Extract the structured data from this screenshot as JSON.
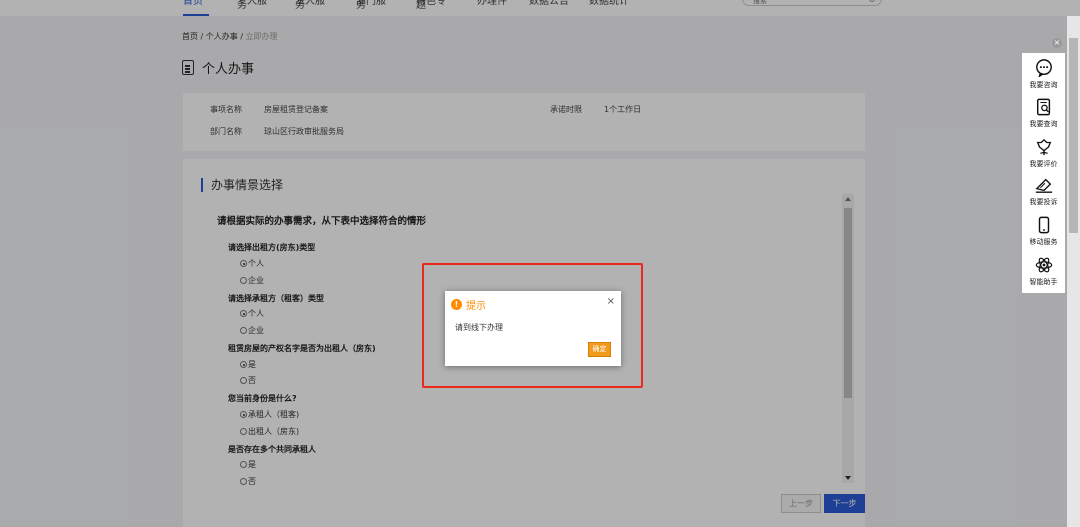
{
  "nav": {
    "items": [
      "首页",
      "个人服务",
      "法人服务",
      "部门服务",
      "特色专题",
      "办理件",
      "数据公告",
      "数据统计"
    ],
    "search_placeholder": "搜索"
  },
  "breadcrumb": {
    "home": "首页",
    "sep1": " / ",
    "section": "个人办事",
    "sep2": " / ",
    "current": "立即办理"
  },
  "page_title": "个人办事",
  "info": {
    "item_name_label": "事项名称",
    "item_name_value": "房屋租赁登记备案",
    "promise_label": "承诺时限",
    "promise_value": "1个工作日",
    "dept_label": "部门名称",
    "dept_value": "琼山区行政审批服务局"
  },
  "section_title": "办事情景选择",
  "question_head": "请根据实际的办事需求，从下表中选择符合的情形",
  "questions": [
    {
      "q": "请选择出租方(房东)类型",
      "options": [
        {
          "label": "个人",
          "checked": true
        },
        {
          "label": "企业",
          "checked": false
        }
      ]
    },
    {
      "q": "请选择承租方（租客）类型",
      "options": [
        {
          "label": "个人",
          "checked": true
        },
        {
          "label": "企业",
          "checked": false
        }
      ]
    },
    {
      "q": "租赁房屋的产权名字是否为出租人（房东)",
      "options": [
        {
          "label": "是",
          "checked": true
        },
        {
          "label": "否",
          "checked": false
        }
      ]
    },
    {
      "q": "您当前身份是什么?",
      "options": [
        {
          "label": "承租人（租客)",
          "checked": true
        },
        {
          "label": "出租人（房东)",
          "checked": false
        }
      ]
    },
    {
      "q": "是否存在多个共同承租人",
      "options": [
        {
          "label": "是",
          "checked": false
        },
        {
          "label": "否",
          "checked": false
        }
      ]
    }
  ],
  "buttons": {
    "prev": "上一步",
    "next": "下一步"
  },
  "side_panel": {
    "close": "×",
    "items": [
      {
        "label": "我要咨询",
        "icon": "chat-icon"
      },
      {
        "label": "我要查询",
        "icon": "search-doc-icon"
      },
      {
        "label": "我要评价",
        "icon": "flower-icon"
      },
      {
        "label": "我要投诉",
        "icon": "pen-icon"
      },
      {
        "label": "移动服务",
        "icon": "phone-icon"
      },
      {
        "label": "智能助手",
        "icon": "atom-icon"
      }
    ]
  },
  "dialog": {
    "title": "提示",
    "icon": "!",
    "close": "×",
    "message": "请到线下办理",
    "ok": "确定"
  },
  "colors": {
    "accent": "#2a5bd7",
    "warning": "#ff8a00",
    "highlight": "#e8291c"
  }
}
